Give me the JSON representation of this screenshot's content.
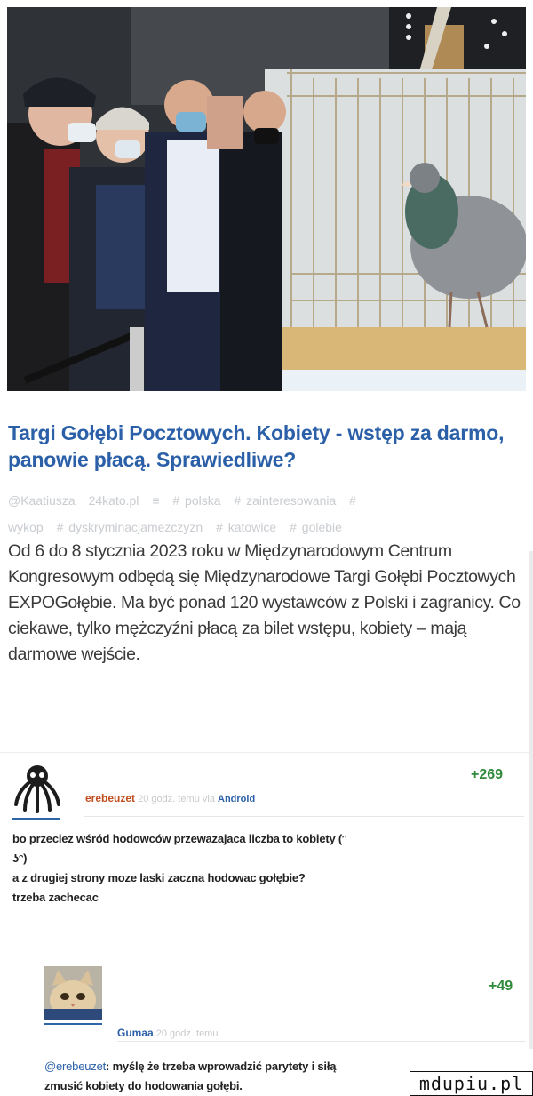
{
  "article": {
    "headline": "Targi Gołębi Pocztowych. Kobiety - wstęp za darmo, panowie płacą. Sprawiedliwe?",
    "tags": [
      "@Kaatiusza",
      "24kato.pl",
      "≡",
      "# polska",
      "# zainteresowania",
      "#",
      "wykop",
      "# dyskryminacjamezczyzn",
      "# katowice",
      "# golebie"
    ],
    "body": "Od 6 do 8 stycznia 2023 roku w Międzynarodowym Centrum Kongresowym odbędą się Międzynarodowe Targi Gołębi Pocztowych EXPOGołębie. Ma być ponad 120 wystawców z Polski i zagranicy. Co ciekawe, tylko mężczyźni płacą za bilet wstępu, kobiety – mają darmowe wejście."
  },
  "comments": [
    {
      "score": "+269",
      "user": "erebeuzet",
      "time": "20 godz. temu",
      "via_label": "via",
      "via": "Android",
      "lines": [
        "bo przeciez wśród hodowców przewazajaca liczba to kobiety (ᵔ",
        "ʖᵔ)",
        "a z drugiej strony moze laski zaczna hodowac gołębie?",
        "trzeba zachecac"
      ]
    },
    {
      "score": "+49",
      "user": "Gumaa",
      "time": "20 godz. temu",
      "mention": "@erebeuzet",
      "line1_rest": ": myślę że trzeba wprowadzić parytety i siłą",
      "line2": "zmusić kobiety do hodowania gołębi."
    }
  ],
  "watermark": "mdupiu.pl",
  "colors": {
    "headline": "#2b60a8",
    "score": "#2f8a3b",
    "username_orange": "#c14e1e",
    "meta_grey": "#c7cacd"
  }
}
